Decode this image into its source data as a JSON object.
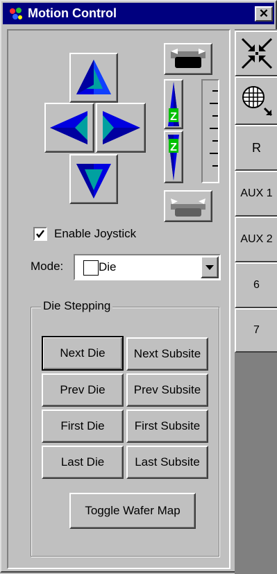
{
  "window": {
    "title": "Motion Control",
    "close_label": "✕"
  },
  "jog": {
    "up_icon": "arrow-up-icon",
    "down_icon": "arrow-down-icon",
    "left_icon": "arrow-left-icon",
    "right_icon": "arrow-right-icon",
    "z_up_label": "Z",
    "z_down_label": "Z"
  },
  "joystick": {
    "checked": true,
    "label": "Enable Joystick"
  },
  "mode": {
    "label": "Mode:",
    "value": "Die"
  },
  "die_stepping": {
    "title": "Die Stepping",
    "next_die": "Next Die",
    "next_subsite": "Next Subsite",
    "prev_die": "Prev Die",
    "prev_subsite": "Prev Subsite",
    "first_die": "First Die",
    "first_subsite": "First Subsite",
    "last_die": "Last Die",
    "last_subsite": "Last Subsite",
    "toggle_wafer_map": "Toggle Wafer Map"
  },
  "side_tabs": [
    {
      "label": "",
      "icon": "collapse-arrows-icon"
    },
    {
      "label": "",
      "icon": "wafer-grid-icon"
    },
    {
      "label": "R"
    },
    {
      "label": "AUX 1"
    },
    {
      "label": "AUX 2"
    },
    {
      "label": "6"
    },
    {
      "label": "7"
    }
  ],
  "colors": {
    "titlebar": "#00007f",
    "face": "#c0c0c0",
    "arrow_blue": "#0000ff",
    "arrow_teal": "#00a0a0"
  }
}
